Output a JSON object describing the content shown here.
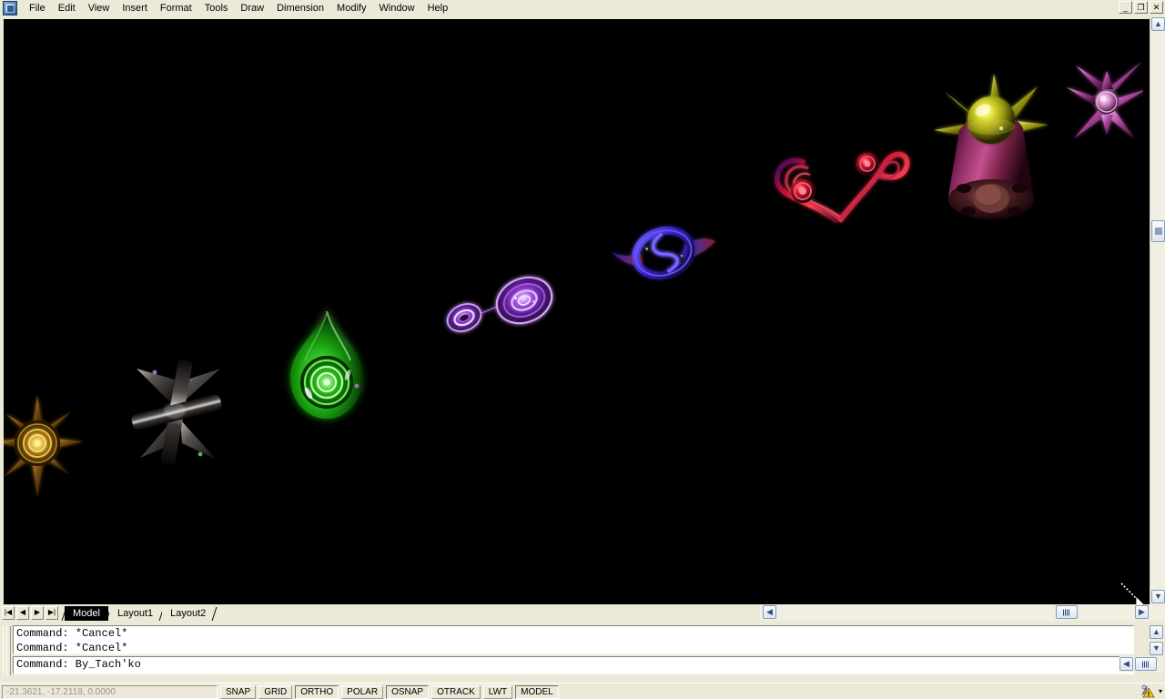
{
  "window": {
    "app_icon": "autocad-app-icon",
    "controls": [
      {
        "name": "minimize-button",
        "glyph": "_"
      },
      {
        "name": "restore-button",
        "glyph": "❐"
      },
      {
        "name": "close-button",
        "glyph": "✕"
      }
    ]
  },
  "menubar": {
    "items": [
      {
        "label": "File"
      },
      {
        "label": "Edit"
      },
      {
        "label": "View"
      },
      {
        "label": "Insert"
      },
      {
        "label": "Format"
      },
      {
        "label": "Tools"
      },
      {
        "label": "Draw"
      },
      {
        "label": "Dimension"
      },
      {
        "label": "Modify"
      },
      {
        "label": "Window"
      },
      {
        "label": "Help"
      }
    ]
  },
  "canvas": {
    "background": "#000000",
    "objects": [
      {
        "name": "gold-sunburst-star",
        "label": "Gold sunburst with concentric rings",
        "color": "#e8a317"
      },
      {
        "name": "chrome-asterisk",
        "label": "Dark chrome asterisk cross",
        "color": "#2a2520"
      },
      {
        "name": "green-teardrop",
        "label": "Green glowing teardrop with rings",
        "color": "#2ee02e"
      },
      {
        "name": "purple-double-torus",
        "label": "Purple double torus pair",
        "color": "#9a4fd8"
      },
      {
        "name": "blue-winged-ring",
        "label": "Blue winged ring with S curve",
        "color": "#3a2bd0"
      },
      {
        "name": "red-heart-spiral",
        "label": "Red heart spiral swirl",
        "color": "#e02040"
      },
      {
        "name": "magenta-spiked-cone",
        "label": "Magenta cone with yellow orb crown",
        "color": "#b43a8c"
      },
      {
        "name": "pink-cone-star",
        "label": "Pink radiating cone star",
        "color": "#e070c8"
      }
    ]
  },
  "layout_tabs": {
    "nav": [
      {
        "name": "first-tab-button",
        "glyph": "|◀"
      },
      {
        "name": "prev-tab-button",
        "glyph": "◀"
      },
      {
        "name": "next-tab-button",
        "glyph": "▶"
      },
      {
        "name": "last-tab-button",
        "glyph": "▶|"
      }
    ],
    "tabs": [
      {
        "label": "Model",
        "active": true
      },
      {
        "label": "Layout1",
        "active": false
      },
      {
        "label": "Layout2",
        "active": false
      }
    ]
  },
  "command_window": {
    "history": [
      "Command: *Cancel*",
      "Command: *Cancel*"
    ],
    "prompt": "Command: By_Tach'ko"
  },
  "statusbar": {
    "coordinates": "-21.3621, -17.2118, 0.0000",
    "toggles": [
      {
        "label": "SNAP",
        "active": false
      },
      {
        "label": "GRID",
        "active": false
      },
      {
        "label": "ORTHO",
        "active": true
      },
      {
        "label": "POLAR",
        "active": false
      },
      {
        "label": "OSNAP",
        "active": true
      },
      {
        "label": "OTRACK",
        "active": false
      },
      {
        "label": "LWT",
        "active": false
      },
      {
        "label": "MODEL",
        "active": true
      }
    ],
    "tray": {
      "icon": "warning-communication-icon",
      "caret": "▾"
    }
  },
  "scrollbars": {
    "vertical": {
      "up": "▲",
      "down": "▼"
    },
    "horizontal": {
      "left": "◀",
      "right": "▶"
    }
  }
}
